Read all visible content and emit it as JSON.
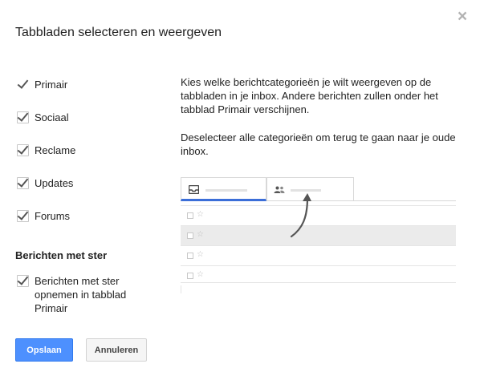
{
  "dialog": {
    "title": "Tabbladen selecteren en weergeven",
    "close_icon": "close-icon"
  },
  "categories": [
    {
      "label": "Primair",
      "checked": true,
      "disabled": true
    },
    {
      "label": "Sociaal",
      "checked": true
    },
    {
      "label": "Reclame",
      "checked": true
    },
    {
      "label": "Updates",
      "checked": true
    },
    {
      "label": "Forums",
      "checked": true
    }
  ],
  "starred": {
    "section_title": "Berichten met ster",
    "option_label_line1": "Berichten met ster",
    "option_label_line2": "opnemen in tabblad",
    "option_label_line3": "Primair",
    "checked": true
  },
  "description": {
    "paragraph1": "Kies welke berichtcategorieën je wilt weergeven op de tabbladen in je inbox. Andere berichten zullen onder het tabblad Primair verschijnen.",
    "paragraph2": "Deselecteer alle categorieën om terug te gaan naar je oude inbox."
  },
  "preview": {
    "tab1_icon": "inbox-icon",
    "tab2_icon": "people-icon",
    "star_glyph": "☆",
    "rows": [
      {
        "shaded": false
      },
      {
        "shaded": true
      },
      {
        "shaded": false
      },
      {
        "shaded": false
      }
    ],
    "accent_color": "#3b6ed8"
  },
  "buttons": {
    "save_label": "Opslaan",
    "cancel_label": "Annuleren"
  },
  "colors": {
    "primary_button": "#4d90fe",
    "close_icon": "#b3b3b3"
  }
}
